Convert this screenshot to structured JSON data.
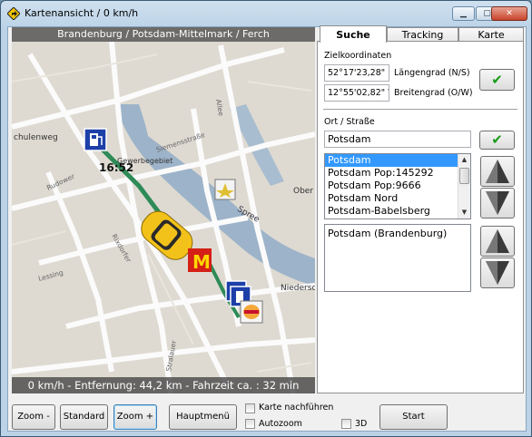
{
  "window": {
    "title": "Kartenansicht / 0 km/h"
  },
  "map": {
    "header": "Brandenburg / Potsdam-Mittelmark / Ferch",
    "footer": "0 km/h - Entfernung: 44,2 km - Fahrzeit ca. : 32 min",
    "time": "16:52",
    "street_labels": [
      "chulenweg",
      "Gewerbegebiet",
      "Spree",
      "Ober",
      "Niedersc",
      "Siemensstraße",
      "Rudower",
      "Rixdorfer",
      "Lessing",
      "Stralauer",
      "Allee"
    ]
  },
  "tabs": [
    {
      "label": "Suche",
      "active": true
    },
    {
      "label": "Tracking",
      "active": false
    },
    {
      "label": "Karte",
      "active": false
    }
  ],
  "search": {
    "coords_label": "Zielkoordinaten",
    "lat_value": "52°17'23,28\" N",
    "lat_label": "Längengrad (N/S)",
    "lon_value": "12°55'02,82\" W",
    "lon_label": "Breitengrad (O/W)",
    "place_label": "Ort / Straße",
    "place_value": "Potsdam",
    "results": [
      "Potsdam",
      "Potsdam   Pop:145292",
      "Potsdam   Pop:9666",
      "Potsdam Nord",
      "Potsdam-Babelsberg"
    ],
    "selected_index": 0,
    "detail_items": [
      "Potsdam (Brandenburg)"
    ]
  },
  "toolbar": {
    "zoom_out": "Zoom -",
    "standard": "Standard",
    "zoom_in": "Zoom +",
    "main_menu": "Hauptmenü",
    "follow_map": "Karte nachführen",
    "autozoom": "Autozoom",
    "three_d": "3D",
    "start": "Start"
  },
  "colors": {
    "ok_check": "#1a9b1a",
    "selection": "#3399ff",
    "car": "#f2c21a",
    "route": "#2e8b57"
  },
  "icons": [
    "navigation-diamond-icon",
    "minimize-icon",
    "maximize-icon",
    "close-icon",
    "fuel-station-icon",
    "mcdonalds-icon",
    "burger-king-icon",
    "star-poi-icon",
    "car-icon",
    "check-icon",
    "arrow-up-icon",
    "arrow-down-icon"
  ]
}
